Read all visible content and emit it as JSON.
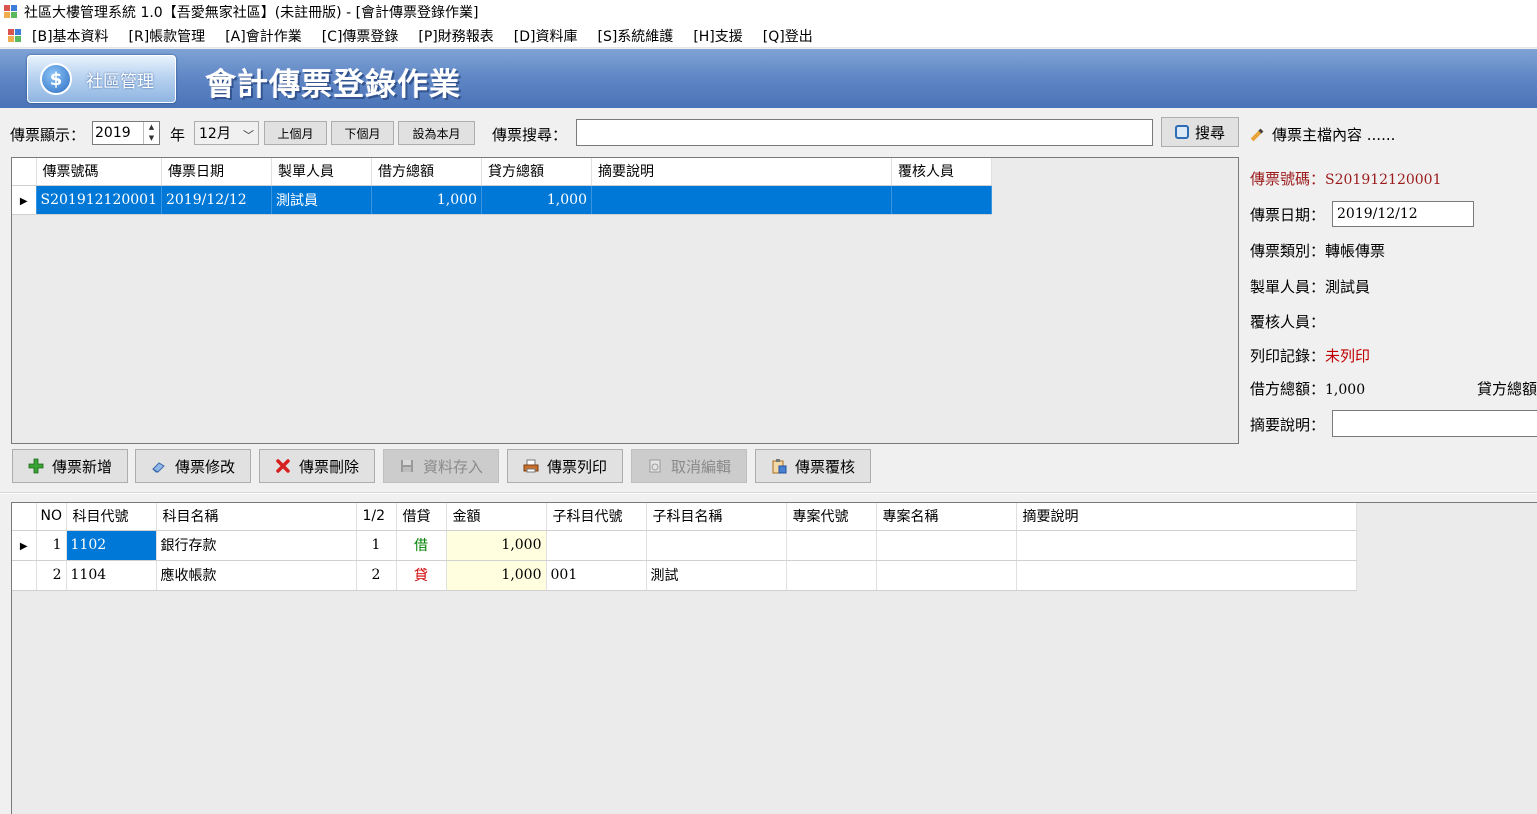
{
  "window": {
    "title": "社區大樓管理系統 1.0【吾愛無家社區】(未註冊版) - [會計傳票登錄作業]"
  },
  "menu": [
    "[B]基本資料",
    "[R]帳款管理",
    "[A]會計作業",
    "[C]傳票登錄",
    "[P]財務報表",
    "[D]資料庫",
    "[S]系統維護",
    "[H]支援",
    "[Q]登出"
  ],
  "banner": {
    "module_label": "社區管理",
    "coin_symbol": "$",
    "title": "會計傳票登錄作業"
  },
  "filter": {
    "display_label": "傳票顯示：",
    "year": "2019",
    "year_label": "年",
    "month": "12月",
    "prev_month": "上個月",
    "next_month": "下個月",
    "this_month": "設為本月",
    "search_label": "傳票搜尋：",
    "search_value": "",
    "search_button": "搜尋",
    "master_label": "傳票主檔內容 ......"
  },
  "voucher_grid": {
    "columns": [
      "傳票號碼",
      "傳票日期",
      "製單人員",
      "借方總額",
      "貸方總額",
      "摘要說明",
      "覆核人員"
    ],
    "rows": [
      {
        "no": "S201912120001",
        "date": "2019/12/12",
        "maker": "測試員",
        "debit": "1,000",
        "credit": "1,000",
        "summary": "",
        "reviewer": ""
      }
    ]
  },
  "detail": {
    "no_label": "傳票號碼：",
    "no_value": "S201912120001",
    "date_label": "傳票日期：",
    "date_value": "2019/12/12",
    "type_label": "傳票類別：",
    "type_value": "轉帳傳票",
    "maker_label": "製單人員：",
    "maker_value": "測試員",
    "reviewer_label": "覆核人員：",
    "reviewer_value": "",
    "print_label": "列印記錄：",
    "print_value": "未列印",
    "debit_label": "借方總額：",
    "debit_value": "1,000",
    "credit_label": "貸方總額",
    "summary_label": "摘要說明：",
    "summary_value": ""
  },
  "actions": {
    "add": "傳票新增",
    "edit": "傳票修改",
    "delete": "傳票刪除",
    "save": "資料存入",
    "print": "傳票列印",
    "cancel": "取消編輯",
    "review": "傳票覆核"
  },
  "entry_grid": {
    "columns": [
      "NO",
      "科目代號",
      "科目名稱",
      "1/2",
      "借貸",
      "金額",
      "子科目代號",
      "子科目名稱",
      "專案代號",
      "專案名稱",
      "摘要說明"
    ],
    "rows": [
      {
        "no": "1",
        "code": "1102",
        "name": "銀行存款",
        "side_num": "1",
        "side": "借",
        "amount": "1,000",
        "sub_code": "",
        "sub_name": "",
        "proj_code": "",
        "proj_name": "",
        "summary": ""
      },
      {
        "no": "2",
        "code": "1104",
        "name": "應收帳款",
        "side_num": "2",
        "side": "貸",
        "amount": "1,000",
        "sub_code": "001",
        "sub_name": "測試",
        "proj_code": "",
        "proj_name": "",
        "summary": ""
      }
    ]
  },
  "colors": {
    "banner": "#5f86c4",
    "selection": "#0078d7",
    "debit": "#008000",
    "credit": "#d00000",
    "amount_bg": "#ffffe0"
  }
}
